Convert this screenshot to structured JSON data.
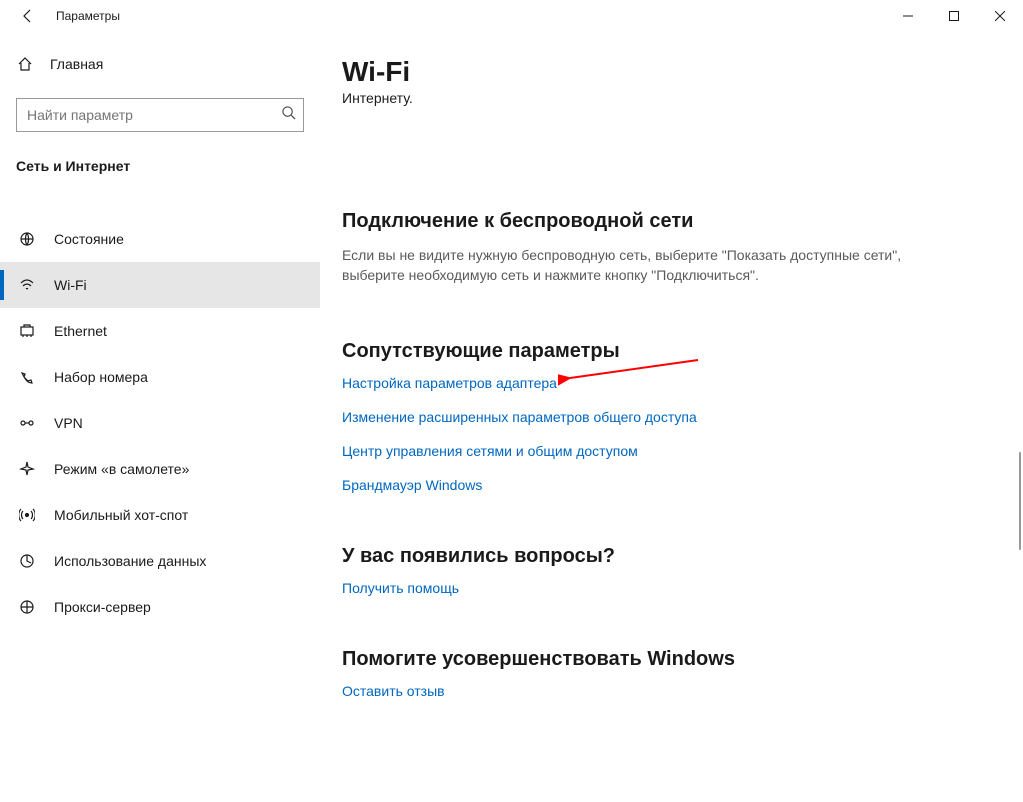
{
  "window": {
    "title": "Параметры"
  },
  "sidebar": {
    "home_label": "Главная",
    "search_placeholder": "Найти параметр",
    "category": "Сеть и Интернет",
    "items": [
      {
        "label": "Состояние",
        "icon": "status"
      },
      {
        "label": "Wi-Fi",
        "icon": "wifi",
        "active": true
      },
      {
        "label": "Ethernet",
        "icon": "ethernet"
      },
      {
        "label": "Набор номера",
        "icon": "dialup"
      },
      {
        "label": "VPN",
        "icon": "vpn"
      },
      {
        "label": "Режим «в самолете»",
        "icon": "airplane"
      },
      {
        "label": "Мобильный хот-спот",
        "icon": "hotspot"
      },
      {
        "label": "Использование данных",
        "icon": "datausage"
      },
      {
        "label": "Прокси-сервер",
        "icon": "proxy"
      }
    ]
  },
  "main": {
    "title": "Wi-Fi",
    "subline": "Интернету.",
    "section_connect": "Подключение к беспроводной сети",
    "connect_text": "Если вы не видите нужную беспроводную сеть, выберите \"Показать доступные сети\", выберите необходимую сеть и нажмите кнопку \"Подключиться\".",
    "section_related": "Сопутствующие параметры",
    "links": [
      "Настройка параметров адаптера",
      "Изменение расширенных параметров общего доступа",
      "Центр управления сетями и общим доступом",
      "Брандмауэр Windows"
    ],
    "section_questions": "У вас появились вопросы?",
    "help_link": "Получить помощь",
    "section_feedback": "Помогите усовершенствовать Windows",
    "feedback_link": "Оставить отзыв"
  }
}
